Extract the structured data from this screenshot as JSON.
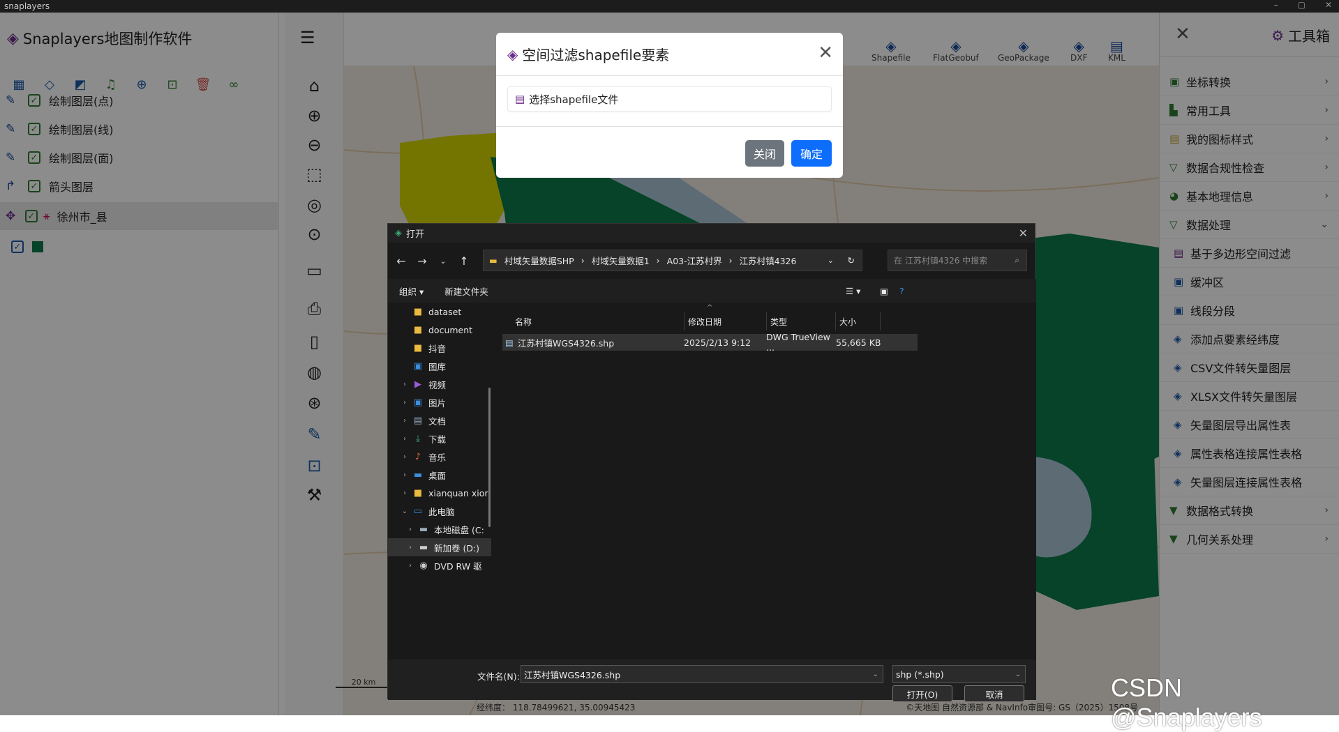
{
  "app_title": "snaplayers",
  "logo_text": "Snaplayers地图制作软件",
  "layers": [
    {
      "label": "绘制图层(点)"
    },
    {
      "label": "绘制图层(线)"
    },
    {
      "label": "绘制图层(面)"
    },
    {
      "label": "箭头图层"
    },
    {
      "label": "徐州市_县"
    }
  ],
  "formats": [
    "Shapefile",
    "FlatGeobuf",
    "GeoPackage",
    "DXF",
    "KML"
  ],
  "toolbox": {
    "title": "工具箱",
    "items": [
      {
        "label": "坐标转换",
        "chevron": "›"
      },
      {
        "label": "常用工具",
        "chevron": "›"
      },
      {
        "label": "我的图标样式",
        "chevron": "›"
      },
      {
        "label": "数据合规性检查",
        "chevron": "›"
      },
      {
        "label": "基本地理信息",
        "chevron": "›"
      },
      {
        "label": "数据处理",
        "chevron": "⌄"
      },
      {
        "label": "基于多边形空间过滤",
        "chevron": ""
      },
      {
        "label": "缓冲区",
        "chevron": ""
      },
      {
        "label": "线段分段",
        "chevron": ""
      },
      {
        "label": "添加点要素经纬度",
        "chevron": ""
      },
      {
        "label": "CSV文件转矢量图层",
        "chevron": ""
      },
      {
        "label": "XLSX文件转矢量图层",
        "chevron": ""
      },
      {
        "label": "矢量图层导出属性表",
        "chevron": ""
      },
      {
        "label": "属性表格连接属性表格",
        "chevron": ""
      },
      {
        "label": "矢量图层连接属性表格",
        "chevron": ""
      },
      {
        "label": "数据格式转换",
        "chevron": "›"
      },
      {
        "label": "几何关系处理",
        "chevron": "›"
      }
    ]
  },
  "modal": {
    "title": "空间过滤shapefile要素",
    "select_label": "选择shapefile文件",
    "close_label": "关闭",
    "ok_label": "确定"
  },
  "file_dialog": {
    "title": "打开",
    "breadcrumb": [
      "村域矢量数据SHP",
      "村域矢量数据1",
      "A03-江苏村界",
      "江苏村镇4326"
    ],
    "search_placeholder": "在 江苏村镇4326 中搜索",
    "organize": "组织",
    "new_folder": "新建文件夹",
    "sidebar": [
      "dataset",
      "document",
      "抖音",
      "图库",
      "视频",
      "图片",
      "文档",
      "下载",
      "音乐",
      "桌面",
      "xianquan xior",
      "此电脑",
      "本地磁盘 (C:",
      "新加卷 (D:)",
      "DVD RW 驱"
    ],
    "columns": [
      "名称",
      "修改日期",
      "类型",
      "大小"
    ],
    "files": [
      {
        "name": "江苏村镇WGS4326.shp",
        "date": "2025/2/13 9:12",
        "type": "DWG TrueView ...",
        "size": "55,665 KB"
      }
    ],
    "filename_label": "文件名(N):",
    "filename_value": "江苏村镇WGS4326.shp",
    "filetype": "shp (*.shp)",
    "open_btn": "打开(O)",
    "cancel_btn": "取消"
  },
  "map": {
    "scale": "20 km",
    "coords": "经纬度：  118.78499621, 35.00945423",
    "credit": "©天地图 自然资源部 & NavInfo审图号: GS（2025）1508号"
  },
  "watermark": "CSDN @Snaplayers",
  "colors": {
    "accent": "#0d6efd",
    "logo": "#6b2c8a",
    "map_green": "#0b7a4b",
    "map_yellow": "#d4d400",
    "map_water": "#a9c3d6"
  }
}
